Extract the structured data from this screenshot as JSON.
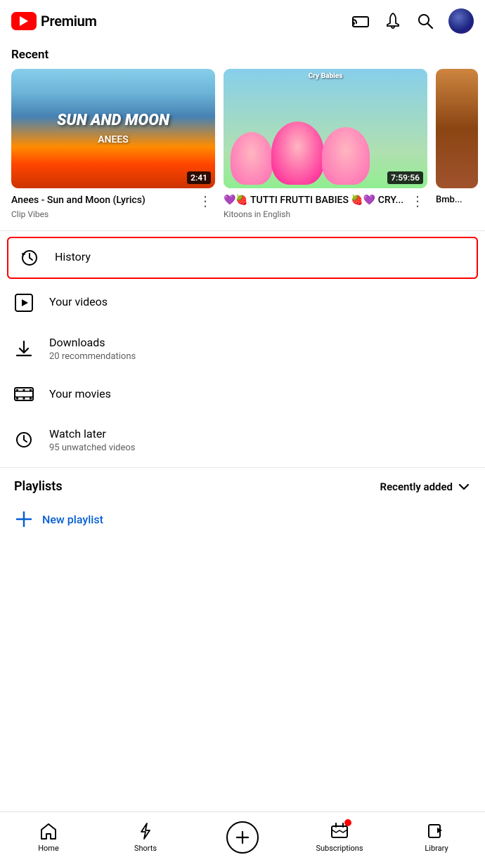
{
  "header": {
    "logo_text": "Premium",
    "cast_icon": "cast-icon",
    "bell_icon": "bell-icon",
    "search_icon": "search-icon",
    "avatar_icon": "avatar-icon"
  },
  "recent": {
    "section_label": "Recent",
    "videos": [
      {
        "id": "v1",
        "title": "Anees - Sun and Moon (Lyrics)",
        "channel": "Clip Vibes",
        "duration": "2:41",
        "thumb_type": "sun_moon"
      },
      {
        "id": "v2",
        "title": "💜🍓 TUTTI FRUTTI BABIES 🍓💜 CRY...",
        "channel": "Kitoons in English",
        "duration": "7:59:56",
        "thumb_type": "cry_babies"
      },
      {
        "id": "v3",
        "title": "Bmb...",
        "channel": "",
        "duration": "",
        "thumb_type": "partial"
      }
    ],
    "thumb1_line1": "SUN AND MOO",
    "thumb1_line2": "N",
    "thumb1_artist": "ANEES",
    "thumb2_logo": "Cry Babies"
  },
  "menu": {
    "items": [
      {
        "id": "history",
        "icon": "history-icon",
        "title": "History",
        "subtitle": "",
        "highlighted": true
      },
      {
        "id": "your-videos",
        "icon": "play-icon",
        "title": "Your videos",
        "subtitle": "",
        "highlighted": false
      },
      {
        "id": "downloads",
        "icon": "download-icon",
        "title": "Downloads",
        "subtitle": "20 recommendations",
        "highlighted": false
      },
      {
        "id": "your-movies",
        "icon": "movies-icon",
        "title": "Your movies",
        "subtitle": "",
        "highlighted": false
      },
      {
        "id": "watch-later",
        "icon": "watch-later-icon",
        "title": "Watch later",
        "subtitle": "95 unwatched videos",
        "highlighted": false
      }
    ]
  },
  "playlists": {
    "title": "Playlists",
    "sort_label": "Recently added",
    "new_playlist_label": "New playlist"
  },
  "bottom_nav": {
    "items": [
      {
        "id": "home",
        "label": "Home",
        "icon": "home-icon"
      },
      {
        "id": "shorts",
        "label": "Shorts",
        "icon": "shorts-icon"
      },
      {
        "id": "add",
        "label": "",
        "icon": "add-icon"
      },
      {
        "id": "subscriptions",
        "label": "Subscriptions",
        "icon": "subscriptions-icon",
        "badge": true
      },
      {
        "id": "library",
        "label": "Library",
        "icon": "library-icon"
      }
    ]
  }
}
